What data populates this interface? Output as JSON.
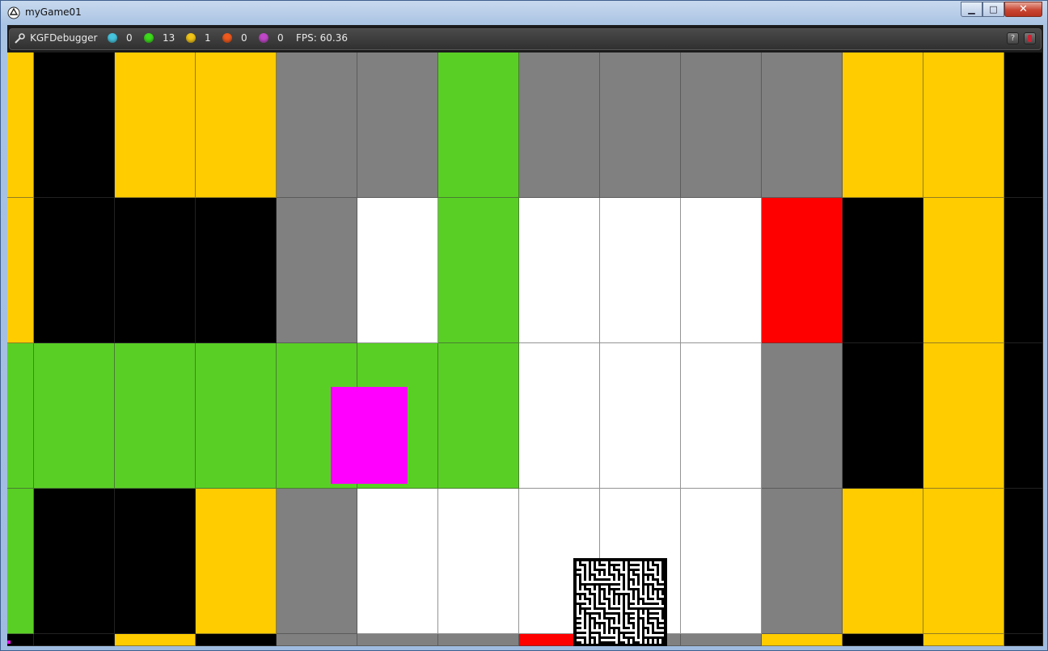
{
  "window": {
    "title": "myGame01",
    "minimize_label": "▁",
    "maximize_label": "□",
    "close_label": "✕"
  },
  "debugger": {
    "name": "KGFDebugger",
    "counters": [
      {
        "icon": "info-icon",
        "color": "#47c6e0",
        "value": "0"
      },
      {
        "icon": "ok-icon",
        "color": "#3ddb1c",
        "value": "13"
      },
      {
        "icon": "warning-icon",
        "color": "#f0c419",
        "value": "1"
      },
      {
        "icon": "error-icon",
        "color": "#f05a1e",
        "value": "0"
      },
      {
        "icon": "fatal-icon",
        "color": "#c048c8",
        "value": "0"
      }
    ],
    "fps": "FPS: 60.36",
    "help_label": "?"
  },
  "palette": {
    "Y": "#ffcc00",
    "K": "#000000",
    "G": "#808080",
    "L": "#59cf25",
    "W": "#ffffff",
    "R": "#ff0000"
  },
  "tiles": [
    "YKYYGGLGGGGYYK",
    "YKKKGWLWWWRKYK",
    "LLLLLLLWWWGKYK",
    "LKKYGWWWWWGYYK",
    "KKYKGGGRGGYKYK"
  ],
  "player_color": "#ff00ff"
}
